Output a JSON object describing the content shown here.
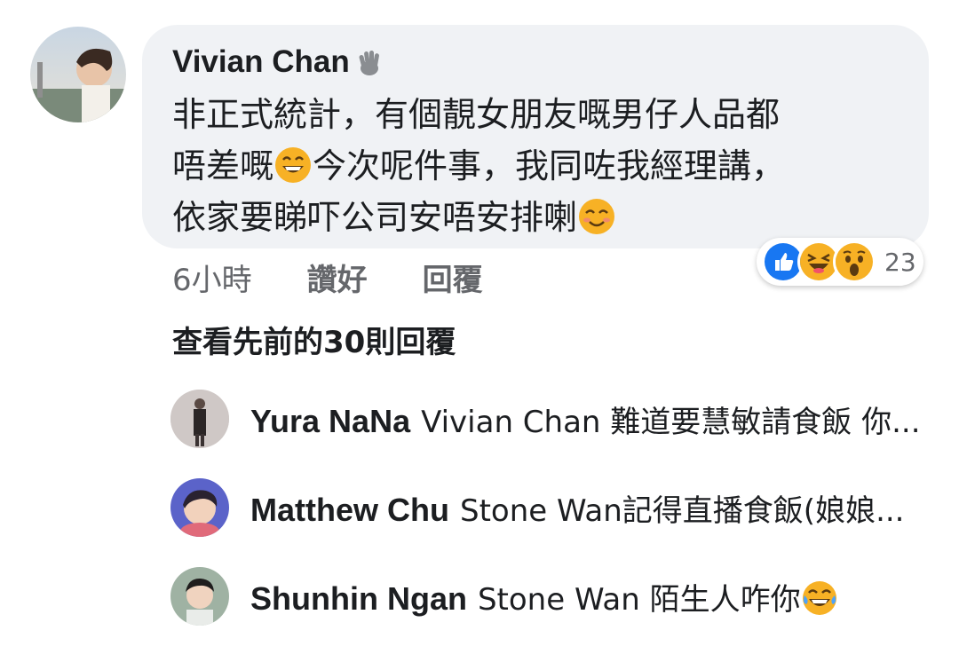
{
  "comment": {
    "author": "Vivian Chan",
    "lines": [
      "非正式統計，有個靚女朋友嘅男仔人品都",
      "唔差嘅",
      "今次呢件事，我同咗我經理講，",
      "依家要睇吓公司安唔安排喇"
    ],
    "time": "6小時",
    "like_label": "讚好",
    "reply_label": "回覆",
    "reaction_count": "23",
    "reactions": [
      "like-icon",
      "laugh-icon",
      "wow-icon"
    ]
  },
  "view_previous_replies": "查看先前的30則回覆",
  "replies": [
    {
      "name": "Yura NaNa",
      "text": "Vivian Chan 難道要慧敏請食飯 你..."
    },
    {
      "name": "Matthew Chu",
      "text": "Stone Wan記得直播食飯(娘娘..."
    },
    {
      "name": "Shunhin Ngan",
      "text": "Stone Wan 陌生人咋你"
    }
  ],
  "colors": {
    "bubble": "#f0f2f5",
    "muted": "#65676b",
    "like_blue": "#1877f2",
    "emoji_yellow": "#f7b125"
  }
}
